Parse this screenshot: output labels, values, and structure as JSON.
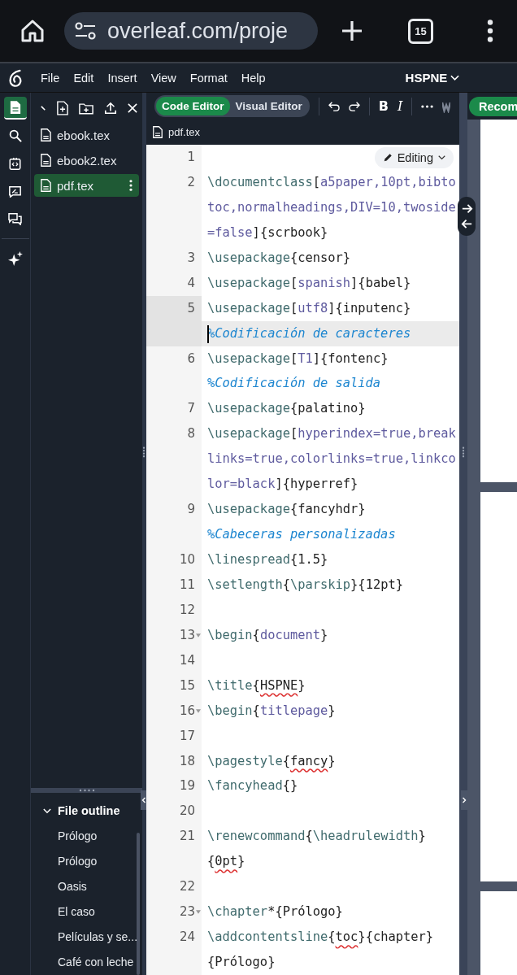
{
  "browser": {
    "url": "overleaf.com/proje",
    "tab_count": "15"
  },
  "menu": {
    "items": [
      "File",
      "Edit",
      "Insert",
      "View",
      "Format",
      "Help"
    ],
    "project_title": "HSPNE"
  },
  "rail": {
    "items": [
      {
        "kind": "files",
        "selected": true
      },
      {
        "kind": "search",
        "selected": false
      },
      {
        "kind": "code",
        "selected": false
      },
      {
        "kind": "review",
        "selected": false
      },
      {
        "kind": "chat",
        "selected": false
      },
      {
        "kind": "ai",
        "selected": false
      }
    ]
  },
  "file_tree": {
    "files": [
      {
        "name": "ebook.tex",
        "selected": false
      },
      {
        "name": "ebook2.tex",
        "selected": false
      },
      {
        "name": "pdf.tex",
        "selected": true
      }
    ]
  },
  "outline": {
    "title": "File outline",
    "expanded": true,
    "items": [
      "Prólogo",
      "Prólogo",
      "Oasis",
      "El caso",
      "Películas y se...",
      "Café con leche"
    ]
  },
  "editor": {
    "modes": [
      {
        "label": "Code Editor",
        "selected": true
      },
      {
        "label": "Visual Editor",
        "selected": false
      }
    ],
    "format_buttons": [
      {
        "kind": "bold",
        "label": "B"
      },
      {
        "kind": "italic",
        "label": "I"
      }
    ],
    "file_tab": "pdf.tex",
    "mode_menu": "Editing",
    "lines": [
      {
        "number": "1",
        "fold": false,
        "active": false
      },
      {
        "number": "2",
        "fold": false,
        "active": false,
        "rows": [
          {
            "tokens": [
              {
                "kind": "cmd",
                "text": "\\documentclass"
              },
              {
                "kind": "plain",
                "text": "["
              },
              {
                "kind": "opt",
                "text": "a5paper,10pt,bibto"
              }
            ]
          },
          {
            "tokens": [
              {
                "kind": "opt",
                "text": "toc,normalheadings,DIV=10,twoside"
              }
            ]
          },
          {
            "tokens": [
              {
                "kind": "opt",
                "text": "=false"
              },
              {
                "kind": "plain",
                "text": "]{scrbook}"
              }
            ]
          }
        ]
      },
      {
        "number": "3",
        "fold": false,
        "active": false,
        "rows": [
          {
            "tokens": [
              {
                "kind": "cmd",
                "text": "\\usepackage"
              },
              {
                "kind": "plain",
                "text": "{censor}"
              }
            ]
          }
        ]
      },
      {
        "number": "4",
        "fold": false,
        "active": false,
        "rows": [
          {
            "tokens": [
              {
                "kind": "cmd",
                "text": "\\usepackage"
              },
              {
                "kind": "plain",
                "text": "["
              },
              {
                "kind": "opt",
                "text": "spanish"
              },
              {
                "kind": "plain",
                "text": "]{babel}"
              }
            ]
          }
        ]
      },
      {
        "number": "5",
        "fold": false,
        "active": true,
        "rows": [
          {
            "tokens": [
              {
                "kind": "cmd",
                "text": "\\usepackage"
              },
              {
                "kind": "plain",
                "text": "["
              },
              {
                "kind": "opt",
                "text": "utf8"
              },
              {
                "kind": "plain",
                "text": "]{inputenc}"
              }
            ]
          },
          {
            "tokens": [
              {
                "kind": "comment",
                "text": "%Codificación de caracteres"
              }
            ]
          }
        ]
      },
      {
        "number": "6",
        "fold": false,
        "active": false,
        "rows": [
          {
            "tokens": [
              {
                "kind": "cmd",
                "text": "\\usepackage"
              },
              {
                "kind": "plain",
                "text": "["
              },
              {
                "kind": "opt",
                "text": "T1"
              },
              {
                "kind": "plain",
                "text": "]{fontenc}"
              }
            ]
          },
          {
            "tokens": [
              {
                "kind": "comment",
                "text": "%Codificación de salida"
              }
            ]
          }
        ]
      },
      {
        "number": "7",
        "fold": false,
        "active": false,
        "rows": [
          {
            "tokens": [
              {
                "kind": "cmd",
                "text": "\\usepackage"
              },
              {
                "kind": "plain",
                "text": "{palatino}"
              }
            ]
          }
        ]
      },
      {
        "number": "8",
        "fold": false,
        "active": false,
        "rows": [
          {
            "tokens": [
              {
                "kind": "cmd",
                "text": "\\usepackage"
              },
              {
                "kind": "plain",
                "text": "["
              },
              {
                "kind": "opt",
                "text": "hyperindex=true,break"
              }
            ]
          },
          {
            "tokens": [
              {
                "kind": "opt",
                "text": "links=true,colorlinks=true,linkco"
              }
            ]
          },
          {
            "tokens": [
              {
                "kind": "opt",
                "text": "lor=black"
              },
              {
                "kind": "plain",
                "text": "]{hyperref}"
              }
            ]
          }
        ]
      },
      {
        "number": "9",
        "fold": false,
        "active": false,
        "rows": [
          {
            "tokens": [
              {
                "kind": "cmd",
                "text": "\\usepackage"
              },
              {
                "kind": "plain",
                "text": "{fancyhdr}"
              }
            ]
          },
          {
            "tokens": [
              {
                "kind": "comment",
                "text": "%Cabeceras personalizadas"
              }
            ]
          }
        ]
      },
      {
        "number": "10",
        "fold": false,
        "active": false,
        "rows": [
          {
            "tokens": [
              {
                "kind": "cmd",
                "text": "\\linespread"
              },
              {
                "kind": "plain",
                "text": "{1.5}"
              }
            ]
          }
        ]
      },
      {
        "number": "11",
        "fold": false,
        "active": false,
        "rows": [
          {
            "tokens": [
              {
                "kind": "cmd",
                "text": "\\setlength"
              },
              {
                "kind": "plain",
                "text": "{"
              },
              {
                "kind": "cmd",
                "text": "\\parskip"
              },
              {
                "kind": "plain",
                "text": "}{12pt}"
              }
            ]
          }
        ]
      },
      {
        "number": "12",
        "fold": false,
        "active": false
      },
      {
        "number": "13",
        "fold": true,
        "active": false,
        "rows": [
          {
            "tokens": [
              {
                "kind": "cmd",
                "text": "\\begin"
              },
              {
                "kind": "plain",
                "text": "{"
              },
              {
                "kind": "opt",
                "text": "document"
              },
              {
                "kind": "plain",
                "text": "}"
              }
            ]
          }
        ]
      },
      {
        "number": "14",
        "fold": false,
        "active": false
      },
      {
        "number": "15",
        "fold": false,
        "active": false,
        "rows": [
          {
            "tokens": [
              {
                "kind": "cmd",
                "text": "\\title"
              },
              {
                "kind": "plain",
                "text": "{"
              },
              {
                "kind": "spell",
                "text": "HSPNE"
              },
              {
                "kind": "plain",
                "text": "}"
              }
            ]
          }
        ]
      },
      {
        "number": "16",
        "fold": true,
        "active": false,
        "rows": [
          {
            "tokens": [
              {
                "kind": "cmd",
                "text": "\\begin"
              },
              {
                "kind": "plain",
                "text": "{"
              },
              {
                "kind": "opt",
                "text": "titlepage"
              },
              {
                "kind": "plain",
                "text": "}"
              }
            ]
          }
        ]
      },
      {
        "number": "17",
        "fold": false,
        "active": false
      },
      {
        "number": "18",
        "fold": false,
        "active": false,
        "rows": [
          {
            "tokens": [
              {
                "kind": "cmd",
                "text": "\\pagestyle"
              },
              {
                "kind": "plain",
                "text": "{"
              },
              {
                "kind": "spell",
                "text": "fancy"
              },
              {
                "kind": "plain",
                "text": "}"
              }
            ]
          }
        ]
      },
      {
        "number": "19",
        "fold": false,
        "active": false,
        "rows": [
          {
            "tokens": [
              {
                "kind": "cmd",
                "text": "\\fancyhead"
              },
              {
                "kind": "plain",
                "text": "{}"
              }
            ]
          }
        ]
      },
      {
        "number": "20",
        "fold": false,
        "active": false
      },
      {
        "number": "21",
        "fold": false,
        "active": false,
        "rows": [
          {
            "tokens": [
              {
                "kind": "cmd",
                "text": "\\renewcommand"
              },
              {
                "kind": "plain",
                "text": "{"
              },
              {
                "kind": "cmd",
                "text": "\\headrulewidth"
              },
              {
                "kind": "plain",
                "text": "}"
              }
            ]
          },
          {
            "tokens": [
              {
                "kind": "plain",
                "text": "{"
              },
              {
                "kind": "spell",
                "text": "0pt"
              },
              {
                "kind": "plain",
                "text": "}"
              }
            ]
          }
        ]
      },
      {
        "number": "22",
        "fold": false,
        "active": false
      },
      {
        "number": "23",
        "fold": true,
        "active": false,
        "rows": [
          {
            "tokens": [
              {
                "kind": "cmd",
                "text": "\\chapter"
              },
              {
                "kind": "plain",
                "text": "*{Prólogo}"
              }
            ]
          }
        ]
      },
      {
        "number": "24",
        "fold": false,
        "active": false,
        "rows": [
          {
            "tokens": [
              {
                "kind": "cmd",
                "text": "\\addcontentsline"
              },
              {
                "kind": "plain",
                "text": "{"
              },
              {
                "kind": "spell",
                "text": "toc"
              },
              {
                "kind": "plain",
                "text": "}{chapter}"
              }
            ]
          },
          {
            "tokens": [
              {
                "kind": "plain",
                "text": "{Prólogo}"
              }
            ]
          }
        ]
      }
    ]
  },
  "pdf": {
    "recompile_label": "Recom"
  }
}
